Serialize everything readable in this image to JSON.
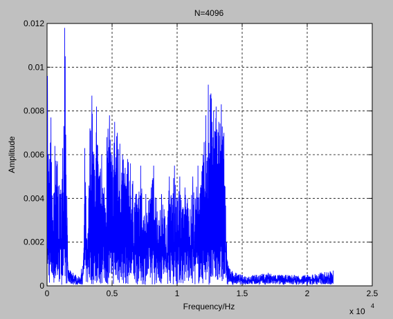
{
  "chart_data": {
    "type": "line",
    "title": "N=4096",
    "xlabel": "Frequency/Hz",
    "ylabel": "Amplitude",
    "x_exponent_label": "x 10",
    "x_exponent_power": "4",
    "xlim": [
      0,
      2.5
    ],
    "ylim": [
      0,
      0.012
    ],
    "x_ticks": [
      0,
      0.5,
      1,
      1.5,
      2,
      2.5
    ],
    "x_tick_labels": [
      "0",
      "0.5",
      "1",
      "1.5",
      "2",
      "2.5"
    ],
    "y_ticks": [
      0,
      0.002,
      0.004,
      0.006,
      0.008,
      0.01,
      0.012
    ],
    "y_tick_labels": [
      "0",
      "0.002",
      "0.004",
      "0.006",
      "0.008",
      "0.01",
      "0.012"
    ],
    "grid": true,
    "series_color": "#0000ff",
    "peaks": [
      [
        0.0,
        0.0035
      ],
      [
        0.003,
        0.0096
      ],
      [
        0.01,
        0.006
      ],
      [
        0.02,
        0.0058
      ],
      [
        0.03,
        0.0077
      ],
      [
        0.045,
        0.003
      ],
      [
        0.06,
        0.0064
      ],
      [
        0.08,
        0.0057
      ],
      [
        0.1,
        0.0042
      ],
      [
        0.12,
        0.0063
      ],
      [
        0.135,
        0.0118
      ],
      [
        0.14,
        0.0105
      ],
      [
        0.16,
        0.0008
      ],
      [
        0.2,
        0.0006
      ],
      [
        0.25,
        0.0004
      ],
      [
        0.28,
        0.0012
      ],
      [
        0.29,
        0.0063
      ],
      [
        0.31,
        0.0015
      ],
      [
        0.33,
        0.0072
      ],
      [
        0.345,
        0.0087
      ],
      [
        0.36,
        0.006
      ],
      [
        0.38,
        0.0082
      ],
      [
        0.4,
        0.005
      ],
      [
        0.42,
        0.006
      ],
      [
        0.44,
        0.0045
      ],
      [
        0.46,
        0.0068
      ],
      [
        0.48,
        0.0078
      ],
      [
        0.5,
        0.006
      ],
      [
        0.52,
        0.0075
      ],
      [
        0.54,
        0.007
      ],
      [
        0.56,
        0.0065
      ],
      [
        0.58,
        0.006
      ],
      [
        0.6,
        0.0054
      ],
      [
        0.62,
        0.0058
      ],
      [
        0.64,
        0.0056
      ],
      [
        0.66,
        0.0048
      ],
      [
        0.7,
        0.004
      ],
      [
        0.72,
        0.0055
      ],
      [
        0.74,
        0.003
      ],
      [
        0.76,
        0.0042
      ],
      [
        0.78,
        0.0039
      ],
      [
        0.8,
        0.0045
      ],
      [
        0.82,
        0.0055
      ],
      [
        0.84,
        0.004
      ],
      [
        0.86,
        0.003
      ],
      [
        0.88,
        0.0042
      ],
      [
        0.9,
        0.0035
      ],
      [
        0.92,
        0.0028
      ],
      [
        0.94,
        0.005
      ],
      [
        0.96,
        0.004
      ],
      [
        0.98,
        0.0055
      ],
      [
        1.0,
        0.004
      ],
      [
        1.02,
        0.005
      ],
      [
        1.04,
        0.0035
      ],
      [
        1.06,
        0.0045
      ],
      [
        1.08,
        0.004
      ],
      [
        1.1,
        0.0035
      ],
      [
        1.12,
        0.005
      ],
      [
        1.14,
        0.004
      ],
      [
        1.16,
        0.0055
      ],
      [
        1.18,
        0.0045
      ],
      [
        1.2,
        0.006
      ],
      [
        1.22,
        0.0078
      ],
      [
        1.24,
        0.0092
      ],
      [
        1.26,
        0.0088
      ],
      [
        1.28,
        0.008
      ],
      [
        1.3,
        0.0082
      ],
      [
        1.32,
        0.0075
      ],
      [
        1.34,
        0.0083
      ],
      [
        1.36,
        0.007
      ],
      [
        1.38,
        0.002
      ],
      [
        1.4,
        0.0008
      ],
      [
        1.45,
        0.0006
      ],
      [
        1.5,
        0.0005
      ],
      [
        1.6,
        0.0005
      ],
      [
        1.7,
        0.0006
      ],
      [
        1.8,
        0.0005
      ],
      [
        1.9,
        0.0005
      ],
      [
        2.0,
        0.0005
      ],
      [
        2.1,
        0.0006
      ],
      [
        2.2,
        0.0007
      ]
    ]
  }
}
